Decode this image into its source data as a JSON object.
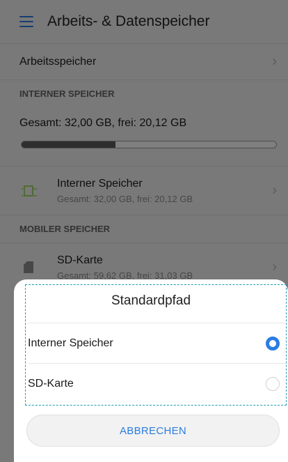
{
  "app_bar": {
    "title": "Arbeits- & Datenspeicher",
    "menu_icon": "hamburger-menu-icon"
  },
  "memory_row": {
    "label": "Arbeitsspeicher"
  },
  "internal_section": {
    "header": "INTERNER SPEICHER",
    "summary": "Gesamt: 32,00 GB, frei: 20,12 GB",
    "usage_fraction": 0.37,
    "item": {
      "title": "Interner Speicher",
      "subtitle": "Gesamt: 32,00 GB, frei: 20,12 GB",
      "icon": "chip-icon"
    }
  },
  "mobile_section": {
    "header": "MOBILER SPEICHER",
    "item": {
      "title": "SD-Karte",
      "subtitle": "Gesamt: 59,62 GB, frei: 31,03 GB",
      "icon": "sd-card-icon"
    }
  },
  "dialog": {
    "title": "Standardpfad",
    "options": [
      {
        "label": "Interner Speicher",
        "selected": true
      },
      {
        "label": "SD-Karte",
        "selected": false
      }
    ],
    "cancel_label": "ABBRECHEN"
  },
  "colors": {
    "accent": "#2a7de1",
    "highlight_dashed": "#1a9bb5"
  }
}
